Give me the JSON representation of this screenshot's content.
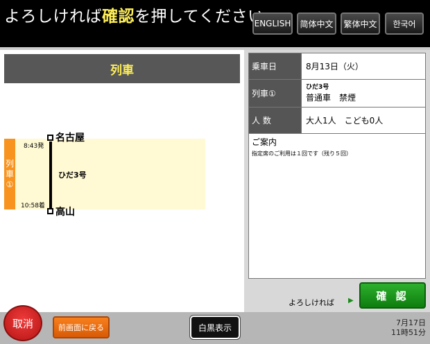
{
  "header": {
    "title_prefix": "よろしければ",
    "title_highlight": "確認",
    "title_suffix": "を押してください",
    "languages": [
      "ENGLISH",
      "简体中文",
      "繁体中文",
      "한국어"
    ]
  },
  "left_panel": {
    "section_title": "列車",
    "train_side_label": [
      "列",
      "車",
      "①"
    ],
    "departure_station": "名古屋",
    "departure_time": "8:43発",
    "arrival_station": "高山",
    "arrival_time": "10:58着",
    "train_name": "ひだ3号"
  },
  "right_panel": {
    "rows": [
      {
        "label": "乗車日",
        "value": "8月13日（火）"
      },
      {
        "label": "列車①",
        "value_small": "ひだ3号",
        "value": "普通車　禁煙"
      },
      {
        "label": "人 数",
        "value": "大人1人　こども0人"
      }
    ],
    "notice_title": "ご案内",
    "notice_text": "指定席のご利用は１回です（残り５回）",
    "ok_prompt": "よろしければ",
    "confirm_label": "確 認"
  },
  "footer": {
    "cancel_label": "取消",
    "back_label": "前画面に戻る",
    "bw_label": "白黒表示",
    "date": "7月17日",
    "time": "11時51分"
  },
  "colors": {
    "header_bg": "#000000",
    "highlight": "#ffef5a",
    "orange": "#f7931e",
    "confirm_green": "#1a9a1a",
    "cancel_red": "#d42020"
  }
}
